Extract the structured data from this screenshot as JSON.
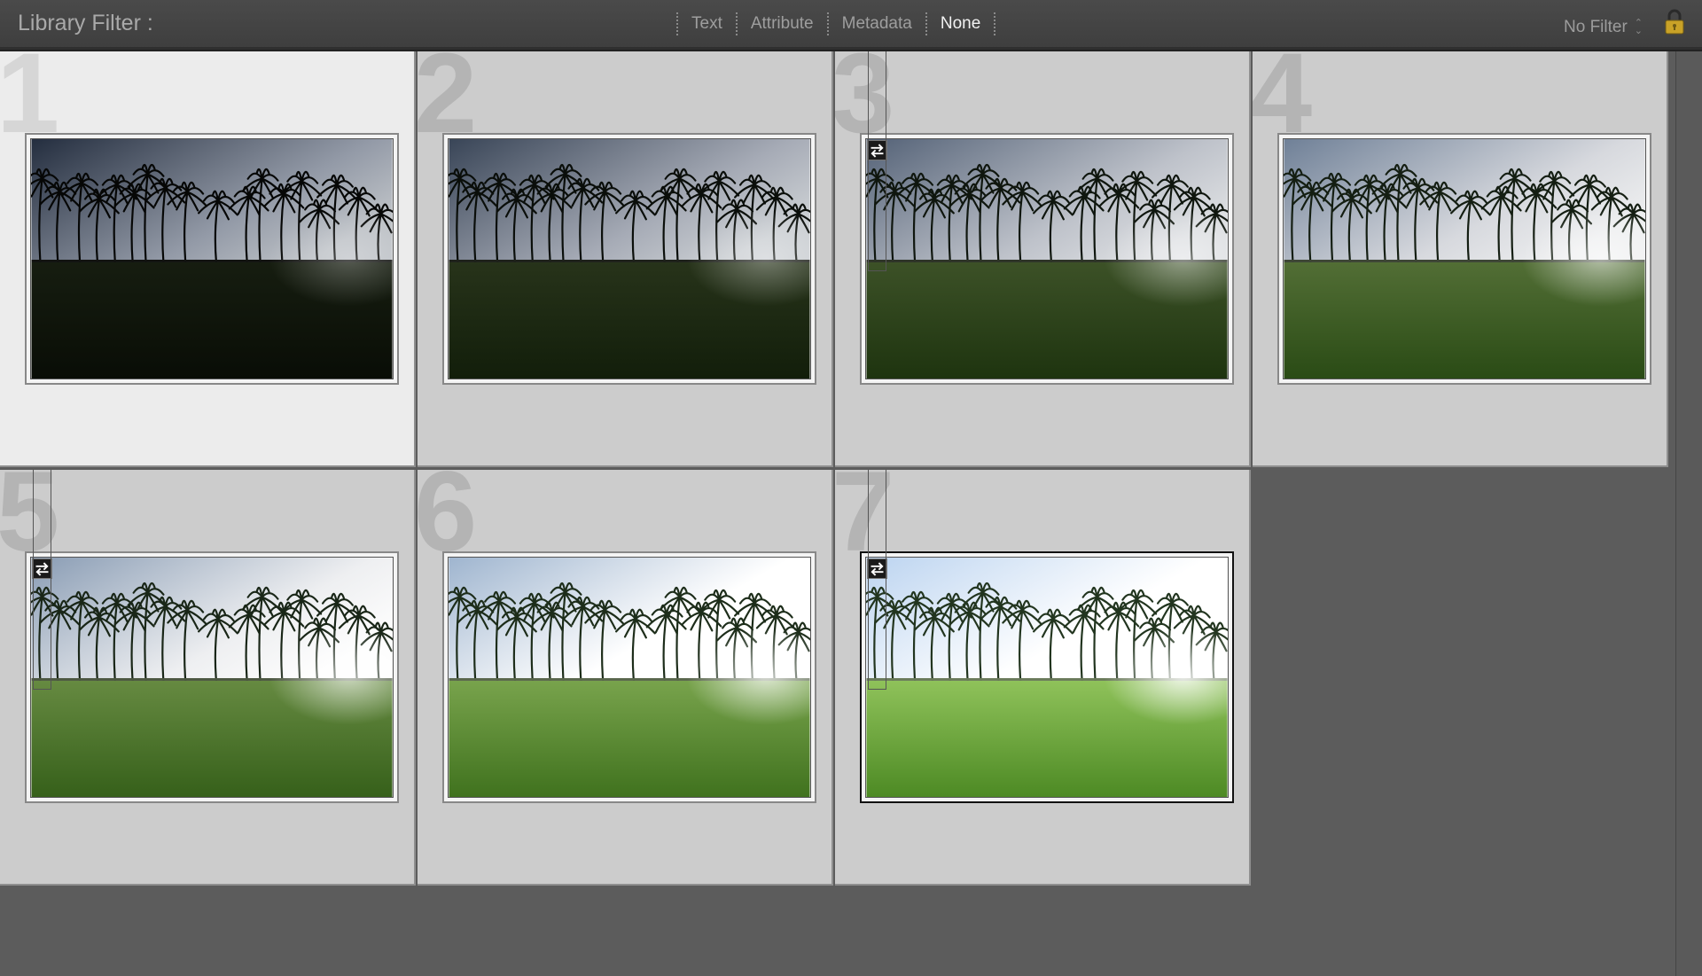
{
  "filter_bar": {
    "title": "Library Filter :",
    "tabs": [
      {
        "label": "Text",
        "active": false
      },
      {
        "label": "Attribute",
        "active": false
      },
      {
        "label": "Metadata",
        "active": false
      },
      {
        "label": "None",
        "active": true
      }
    ],
    "preset": "No Filter",
    "lock_icon": "lock-icon"
  },
  "grid": {
    "cells": [
      {
        "number": "1",
        "selected": true,
        "virtual_copy": false,
        "exposure": 0.05
      },
      {
        "number": "2",
        "selected": false,
        "virtual_copy": false,
        "exposure": 0.18
      },
      {
        "number": "3",
        "selected": false,
        "virtual_copy": true,
        "exposure": 0.35
      },
      {
        "number": "4",
        "selected": false,
        "virtual_copy": false,
        "exposure": 0.52
      },
      {
        "number": "5",
        "selected": false,
        "virtual_copy": true,
        "exposure": 0.68
      },
      {
        "number": "6",
        "selected": false,
        "virtual_copy": false,
        "exposure": 0.82
      },
      {
        "number": "7",
        "selected": false,
        "virtual_copy": true,
        "exposure": 1.0,
        "active": true
      }
    ]
  },
  "colors": {
    "grid_background": "#5c5c5c",
    "cell_background": "#cccccc",
    "cell_selected_background": "#ececec",
    "filter_active": "#f2f2f2",
    "lock_gold": "#c9a227"
  }
}
